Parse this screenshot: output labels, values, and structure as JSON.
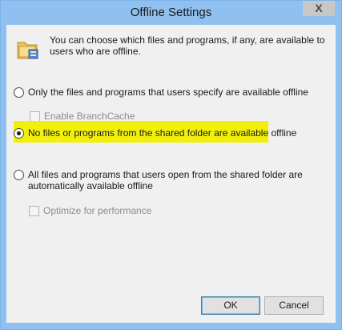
{
  "window": {
    "title": "Offline Settings",
    "close_glyph": "X"
  },
  "intro_text": "You can choose which files and programs, if any, are available to users who are offline.",
  "options": {
    "specify": "Only the files and programs that users specify are available offline",
    "branchcache": "Enable BranchCache",
    "none": "No files or programs from the shared folder are available offline",
    "all": "All files and programs that users open from the shared folder are automatically available offline",
    "optimize": "Optimize for performance"
  },
  "buttons": {
    "ok": "OK",
    "cancel": "Cancel"
  },
  "colors": {
    "title_bar": "#8fc0f0",
    "highlight": "#f2f00a",
    "dialog_bg": "#f0f0f0"
  }
}
